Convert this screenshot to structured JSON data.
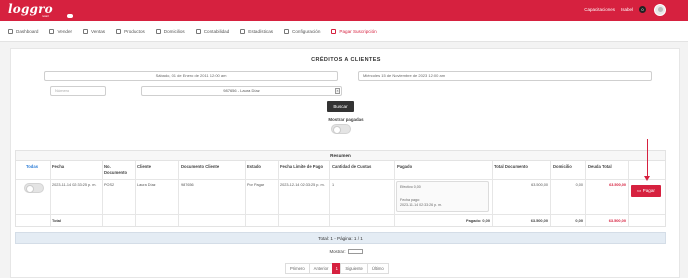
{
  "brand": {
    "logo": "loggro",
    "sub": "retail"
  },
  "topbar": {
    "link": "Capacitaciones",
    "user": "Isabel",
    "badge": "0"
  },
  "nav": [
    {
      "label": "Dashboard",
      "icon": "dashboard-icon"
    },
    {
      "label": "Vender",
      "icon": "sell-icon"
    },
    {
      "label": "Ventas",
      "icon": "sales-icon"
    },
    {
      "label": "Productos",
      "icon": "products-icon"
    },
    {
      "label": "Domicilios",
      "icon": "delivery-icon"
    },
    {
      "label": "Contabilidad",
      "icon": "accounting-icon"
    },
    {
      "label": "Estadísticas",
      "icon": "chart-icon"
    },
    {
      "label": "Configuración",
      "icon": "gear-icon"
    },
    {
      "label": "Pagar Suscripción",
      "icon": "card-icon"
    }
  ],
  "page": {
    "title": "CRÉDITOS A CLIENTES"
  },
  "filters": {
    "date_from": "Sábado, 01 de Enero de 2011 12:00 am",
    "date_to": "Miércoles 15 de Noviembre de 2023 12:00 am",
    "number_placeholder": "Número",
    "client": "987656 - Laura Díaz",
    "client_clear": "×",
    "search_label": "Buscar",
    "show_paid_label": "Mostrar pagadas"
  },
  "table": {
    "section": "Resumen",
    "headers": {
      "todas": "Todas",
      "fecha": "Fecha",
      "no_doc": "No. Documento",
      "cliente": "Cliente",
      "doc_cliente": "Documento Cliente",
      "estado": "Estado",
      "fecha_limite": "Fecha Límite de Pago",
      "cuotas": "Cantidad de Cuotas",
      "pagado": "Pagado",
      "total_doc": "Total Documento",
      "domicilio": "Domicilio",
      "deuda": "Deuda Total"
    },
    "row": {
      "fecha": "2023-11-14 02:33:25 p. m.",
      "no_doc": "POS2",
      "cliente": "Laura Díaz",
      "doc_cliente": "987656",
      "estado": "Por Pagar",
      "fecha_limite": "2023-12-14 02:33:25 p. m.",
      "cuotas": "1",
      "pagado_efectivo": "Efectivo 0,00",
      "pagado_fecha_label": "Fecha pago:",
      "pagado_fecha": "2023-11-14 02:33:26 p. m.",
      "total_doc": "63.500,00",
      "domicilio": "0,00",
      "deuda": "63.500,00",
      "pay_label": "Pagar"
    },
    "footer": {
      "label": "Total",
      "pagado": "Pagado: 0,00",
      "total_doc": "63.500,00",
      "domicilio": "0,00",
      "deuda": "63.500,00"
    }
  },
  "summary": {
    "text": "Total: 1 - Página: 1 / 1"
  },
  "show": {
    "label": "Mostrar:"
  },
  "pagination": {
    "first": "Primero",
    "prev": "Anterior",
    "current": "1",
    "next": "Siguiente",
    "last": "Último"
  },
  "colors": {
    "brand": "#d6213f",
    "link": "#2a7bd6"
  }
}
